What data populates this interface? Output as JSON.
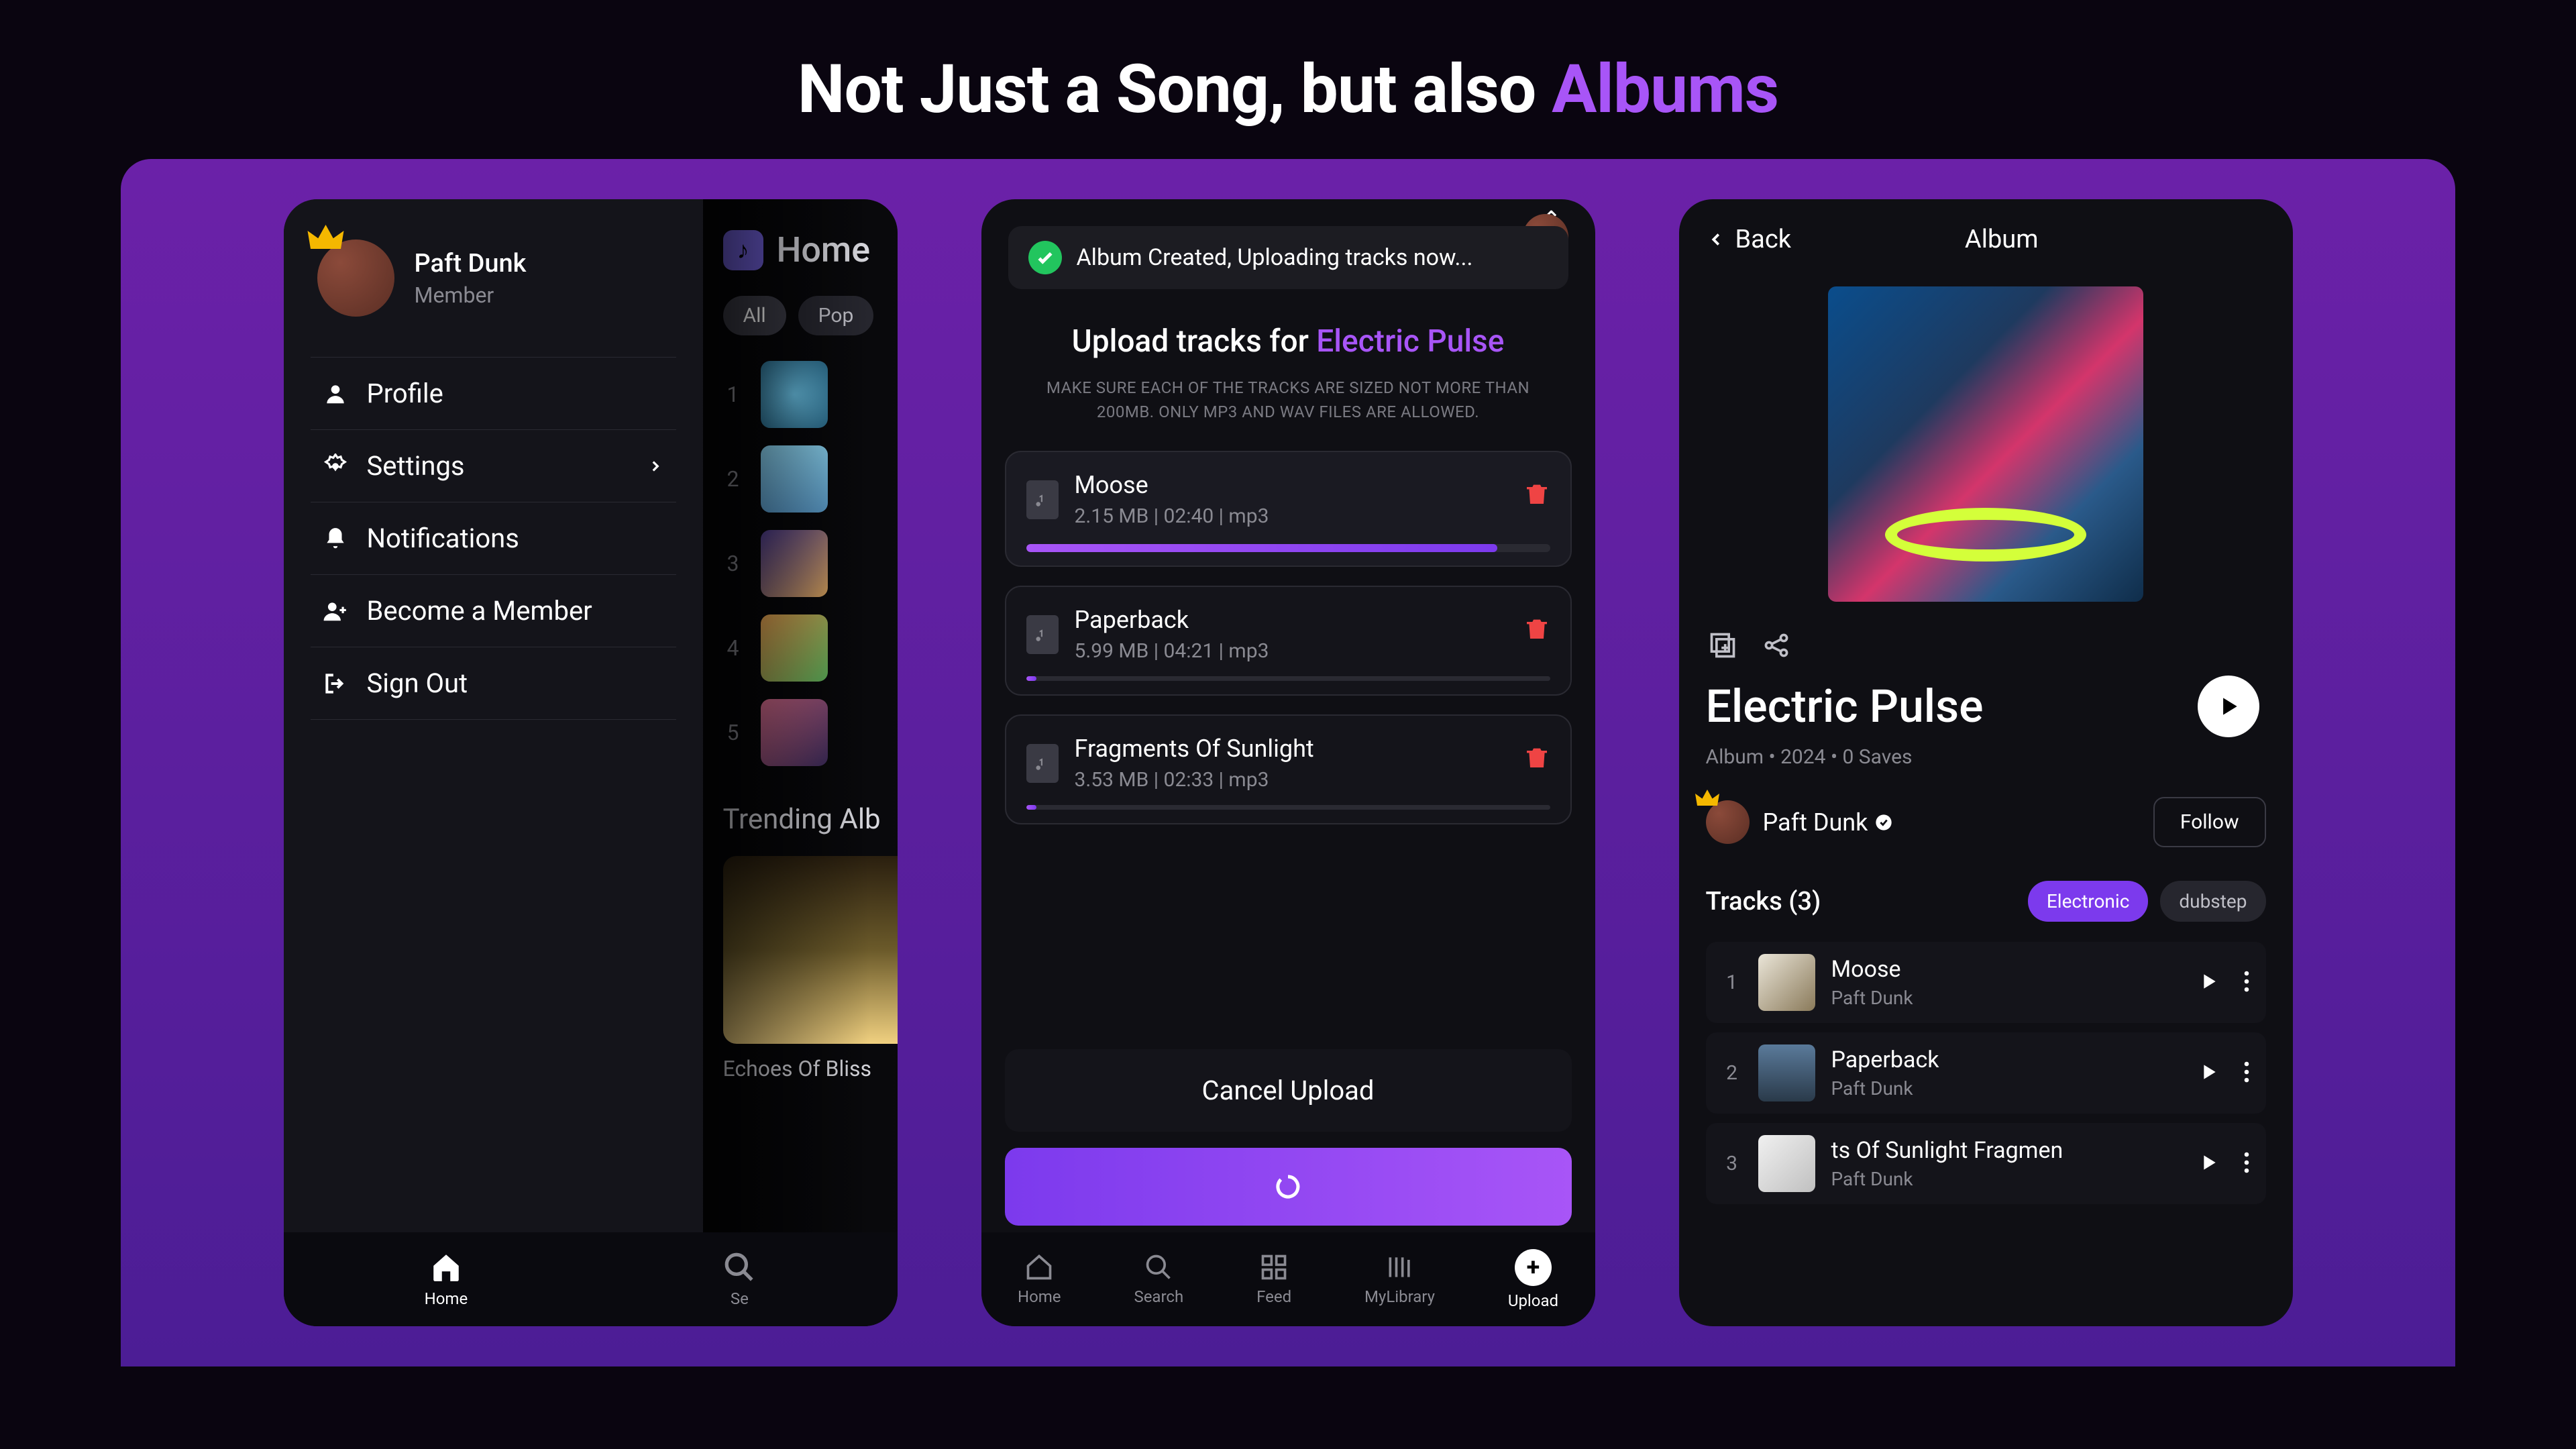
{
  "hero": {
    "pre": "Not Just a Song, but also ",
    "accent": "Albums"
  },
  "colors": {
    "accent": "#a855f7",
    "grad1": "#7c3aed",
    "grad2": "#a855f7",
    "danger": "#ef4444"
  },
  "phone1": {
    "user": {
      "name": "Paft Dunk",
      "role": "Member"
    },
    "menu": {
      "profile": "Profile",
      "settings": "Settings",
      "notifications": "Notifications",
      "member": "Become a Member",
      "signout": "Sign Out"
    },
    "home": {
      "title": "Home",
      "chips": {
        "all": "All",
        "pop": "Pop"
      },
      "trending": "Trending Alb",
      "albumName": "Echoes Of Bliss",
      "tracks": [
        "1",
        "2",
        "3",
        "4",
        "5"
      ]
    },
    "nav": {
      "home": "Home",
      "search": "Se"
    }
  },
  "phone2": {
    "toast": "Album Created, Uploading tracks now...",
    "heading_pre": "Upload tracks for ",
    "heading_accent": "Electric Pulse",
    "sub": "MAKE SURE EACH OF THE TRACKS ARE SIZED NOT MORE THAN 200MB. ONLY MP3 AND WAV FILES ARE ALLOWED.",
    "tracks": [
      {
        "name": "Moose",
        "meta": "2.15 MB | 02:40 | mp3",
        "progress": 90
      },
      {
        "name": "Paperback",
        "meta": "5.99 MB | 04:21 | mp3",
        "progress": 2
      },
      {
        "name": "Fragments Of Sunlight",
        "meta": "3.53 MB | 02:33 | mp3",
        "progress": 2
      }
    ],
    "cancel": "Cancel Upload",
    "nav": {
      "home": "Home",
      "search": "Search",
      "feed": "Feed",
      "library": "MyLibrary",
      "upload": "Upload"
    }
  },
  "phone3": {
    "back": "Back",
    "header": "Album",
    "title": "Electric Pulse",
    "meta": "Album  •  2024  •  0 Saves",
    "artist": "Paft Dunk",
    "follow": "Follow",
    "tracksHeader": "Tracks (3)",
    "tags": {
      "electronic": "Electronic",
      "dubstep": "dubstep"
    },
    "list": [
      {
        "n": "1",
        "name": "Moose",
        "artist": "Paft Dunk"
      },
      {
        "n": "2",
        "name": "Paperback",
        "artist": "Paft Dunk"
      },
      {
        "n": "3",
        "name": "ts Of Sunlight        Fragmen",
        "artist": "Paft Dunk"
      }
    ]
  }
}
